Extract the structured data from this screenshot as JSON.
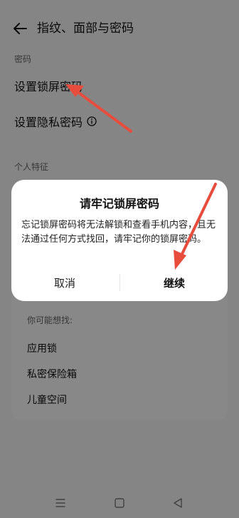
{
  "header": {
    "back_icon": "arrow-left-icon",
    "title": "指纹、面部与密码"
  },
  "sections": {
    "password_label": "密码",
    "set_lock_screen_password": "设置锁屏密码",
    "set_privacy_password": "设置隐私密码",
    "info_icon": "info-icon",
    "personal_features_label": "个人特征"
  },
  "suggestions": {
    "title": "你可能想找:",
    "items": [
      "应用锁",
      "私密保险箱",
      "儿童空间"
    ]
  },
  "dialog": {
    "title": "请牢记锁屏密码",
    "body": "忘记锁屏密码将无法解锁和查看手机内容，且无法通过任何方式找回，请牢记你的锁屏密码。",
    "cancel_label": "取消",
    "continue_label": "继续"
  },
  "navbar": {
    "menu_icon": "menu-icon",
    "home_icon": "square-icon",
    "back_icon": "triangle-back-icon"
  },
  "colors": {
    "annotation_arrow": "#e84c3d",
    "overlay": "#000000"
  }
}
